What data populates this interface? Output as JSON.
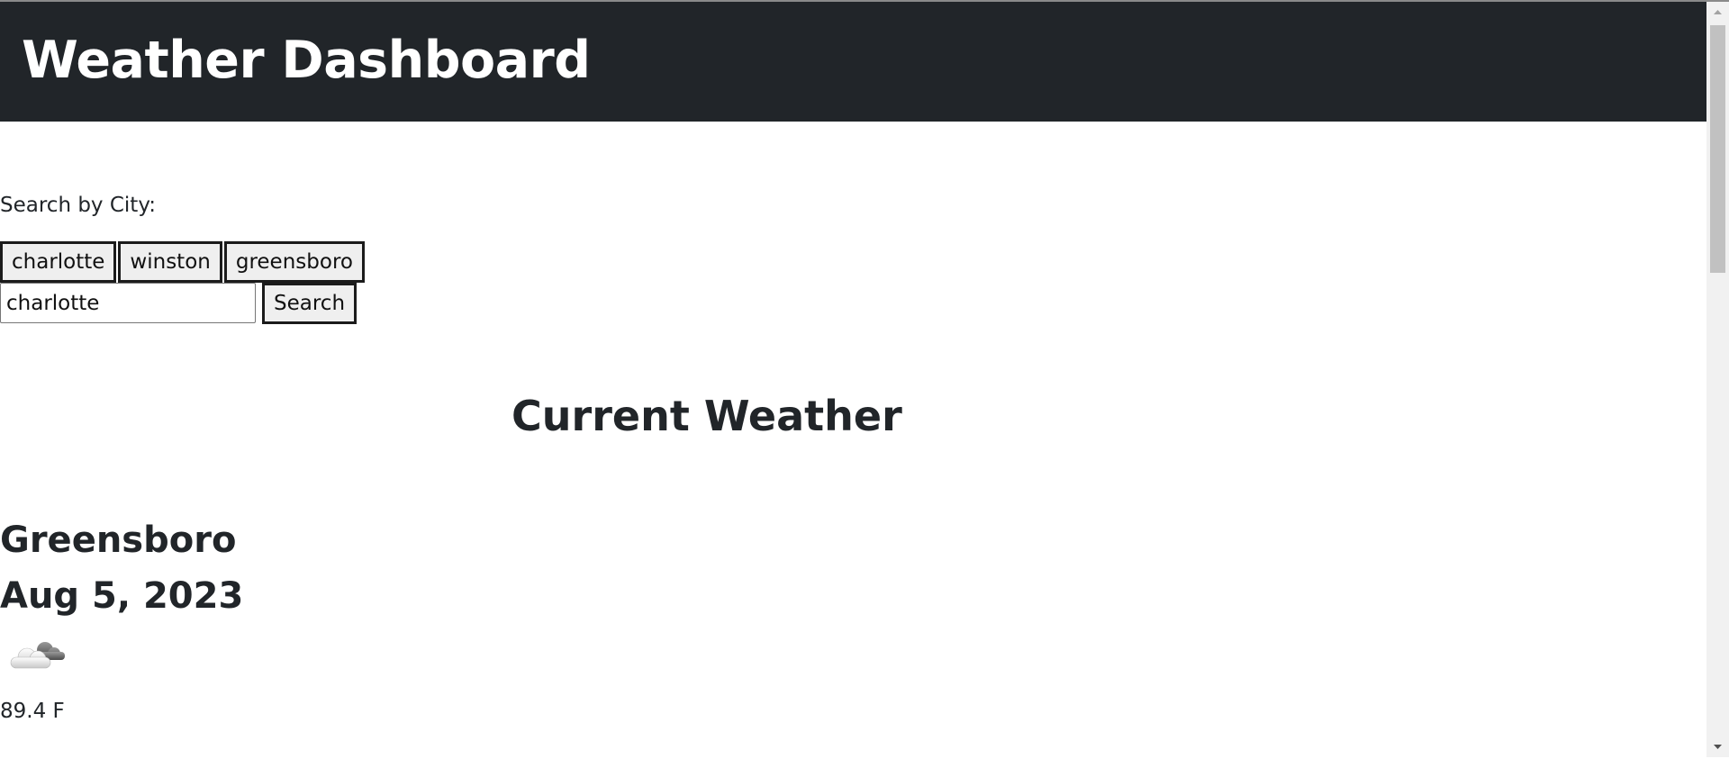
{
  "header": {
    "title": "Weather Dashboard"
  },
  "search": {
    "label": "Search by City:",
    "history": [
      "charlotte",
      "winston",
      "greensboro"
    ],
    "input_value": "charlotte",
    "button_label": "Search"
  },
  "current": {
    "section_title": "Current Weather",
    "city": "Greensboro",
    "date": "Aug 5, 2023",
    "icon": "cloud-icon",
    "temperature": "89.4 F"
  },
  "colors": {
    "header_bg": "#212529",
    "header_text": "#ffffff",
    "text": "#212529"
  }
}
